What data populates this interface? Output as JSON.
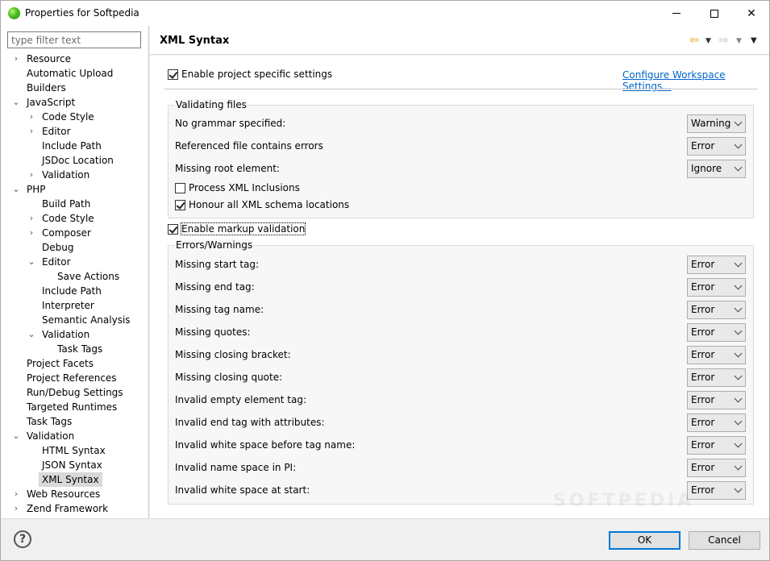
{
  "window": {
    "title": "Properties for Softpedia",
    "minimize": "–",
    "maximize": "□",
    "close": "✕"
  },
  "sidebar": {
    "filter_placeholder": "type filter text",
    "items": [
      {
        "label": "Resource",
        "depth": 0,
        "twisty": "collapsed"
      },
      {
        "label": "Automatic Upload",
        "depth": 0,
        "twisty": "none"
      },
      {
        "label": "Builders",
        "depth": 0,
        "twisty": "none"
      },
      {
        "label": "JavaScript",
        "depth": 0,
        "twisty": "expanded"
      },
      {
        "label": "Code Style",
        "depth": 1,
        "twisty": "collapsed"
      },
      {
        "label": "Editor",
        "depth": 1,
        "twisty": "collapsed"
      },
      {
        "label": "Include Path",
        "depth": 1,
        "twisty": "none"
      },
      {
        "label": "JSDoc Location",
        "depth": 1,
        "twisty": "none"
      },
      {
        "label": "Validation",
        "depth": 1,
        "twisty": "collapsed"
      },
      {
        "label": "PHP",
        "depth": 0,
        "twisty": "expanded"
      },
      {
        "label": "Build Path",
        "depth": 1,
        "twisty": "none"
      },
      {
        "label": "Code Style",
        "depth": 1,
        "twisty": "collapsed"
      },
      {
        "label": "Composer",
        "depth": 1,
        "twisty": "collapsed"
      },
      {
        "label": "Debug",
        "depth": 1,
        "twisty": "none"
      },
      {
        "label": "Editor",
        "depth": 1,
        "twisty": "expanded"
      },
      {
        "label": "Save Actions",
        "depth": 2,
        "twisty": "none"
      },
      {
        "label": "Include Path",
        "depth": 1,
        "twisty": "none"
      },
      {
        "label": "Interpreter",
        "depth": 1,
        "twisty": "none"
      },
      {
        "label": "Semantic Analysis",
        "depth": 1,
        "twisty": "none"
      },
      {
        "label": "Validation",
        "depth": 1,
        "twisty": "expanded"
      },
      {
        "label": "Task Tags",
        "depth": 2,
        "twisty": "none"
      },
      {
        "label": "Project Facets",
        "depth": 0,
        "twisty": "none"
      },
      {
        "label": "Project References",
        "depth": 0,
        "twisty": "none"
      },
      {
        "label": "Run/Debug Settings",
        "depth": 0,
        "twisty": "none"
      },
      {
        "label": "Targeted Runtimes",
        "depth": 0,
        "twisty": "none"
      },
      {
        "label": "Task Tags",
        "depth": 0,
        "twisty": "none"
      },
      {
        "label": "Validation",
        "depth": 0,
        "twisty": "expanded"
      },
      {
        "label": "HTML Syntax",
        "depth": 1,
        "twisty": "none"
      },
      {
        "label": "JSON Syntax",
        "depth": 1,
        "twisty": "none"
      },
      {
        "label": "XML Syntax",
        "depth": 1,
        "twisty": "none",
        "selected": true
      },
      {
        "label": "Web Resources",
        "depth": 0,
        "twisty": "collapsed"
      },
      {
        "label": "Zend Framework",
        "depth": 0,
        "twisty": "collapsed"
      }
    ]
  },
  "header": {
    "title": "XML Syntax",
    "back_icon": "back-arrow-icon",
    "forward_icon": "forward-arrow-icon"
  },
  "settings": {
    "enable_project": {
      "label": "Enable project specific settings",
      "checked": true
    },
    "configure_link": "Configure Workspace Settings...",
    "validating_files": {
      "title": "Validating files",
      "rows": [
        {
          "label": "No grammar specified:",
          "value": "Warning"
        },
        {
          "label": "Referenced file contains errors",
          "value": "Error"
        },
        {
          "label": "Missing root element:",
          "value": "Ignore"
        }
      ],
      "process_xinclude": {
        "label": "Process XML Inclusions",
        "checked": false
      },
      "honour_schema": {
        "label": "Honour all XML schema locations",
        "checked": true
      }
    },
    "enable_markup": {
      "label": "Enable markup validation",
      "checked": true
    },
    "errors_warnings": {
      "title": "Errors/Warnings",
      "rows": [
        {
          "label": "Missing start tag:",
          "value": "Error"
        },
        {
          "label": "Missing end tag:",
          "value": "Error"
        },
        {
          "label": "Missing tag name:",
          "value": "Error"
        },
        {
          "label": "Missing quotes:",
          "value": "Error"
        },
        {
          "label": "Missing closing bracket:",
          "value": "Error"
        },
        {
          "label": "Missing closing quote:",
          "value": "Error"
        },
        {
          "label": "Invalid empty element tag:",
          "value": "Error"
        },
        {
          "label": "Invalid end tag with attributes:",
          "value": "Error"
        },
        {
          "label": "Invalid white space before tag name:",
          "value": "Error"
        },
        {
          "label": "Invalid name space in PI:",
          "value": "Error"
        },
        {
          "label": "Invalid white space at start:",
          "value": "Error"
        }
      ]
    }
  },
  "footer": {
    "help": "?",
    "ok": "OK",
    "cancel": "Cancel"
  },
  "watermark": "SOFTPEDIA"
}
